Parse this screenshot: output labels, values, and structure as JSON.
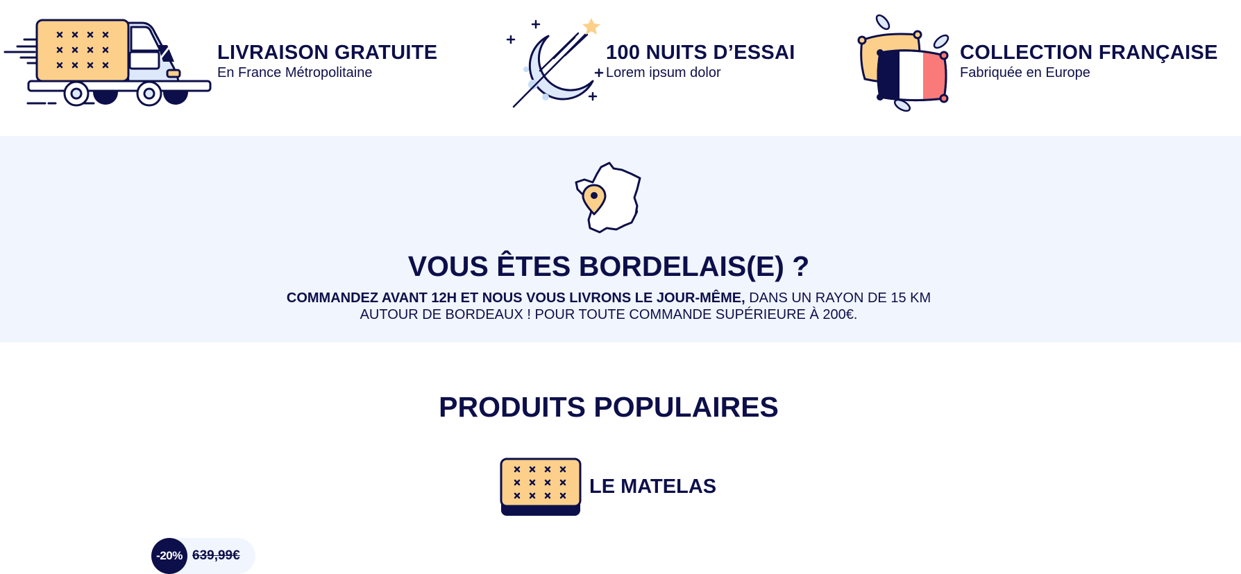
{
  "features": [
    {
      "title": "LIVRAISON GRATUITE",
      "subtitle": "En France Métropolitaine",
      "icon": "delivery-truck-icon"
    },
    {
      "title": "100 NUITS D’ESSAI",
      "subtitle": "Lorem ipsum dolor",
      "icon": "moon-shooting-star-icon"
    },
    {
      "title": "COLLECTION FRANÇAISE",
      "subtitle": "Fabriquée en Europe",
      "icon": "french-flag-pillow-icon"
    }
  ],
  "bordeaux": {
    "icon": "france-map-pin-icon",
    "title": "VOUS ÊTES BORDELAIS(E) ?",
    "line1_bold": "COMMANDEZ AVANT 12H ET NOUS VOUS LIVRONS LE JOUR-MÊME,",
    "line1_regular": " DANS UN RAYON DE 15 KM",
    "line2": "AUTOUR DE BORDEAUX ! POUR TOUTE COMMANDE SUPÉRIEURE À 200€."
  },
  "popular": {
    "title": "PRODUITS POPULAIRES",
    "category": {
      "label": "LE MATELAS",
      "icon": "mattress-icon"
    },
    "product": {
      "discount": "-20%",
      "old_price": "639,99€"
    }
  },
  "colors": {
    "navy": "#0d0f4a",
    "peach": "#fcd08a",
    "light_blue": "#dde9fb",
    "section_bg": "#f1f5fd",
    "flag_red": "#f97a78"
  }
}
